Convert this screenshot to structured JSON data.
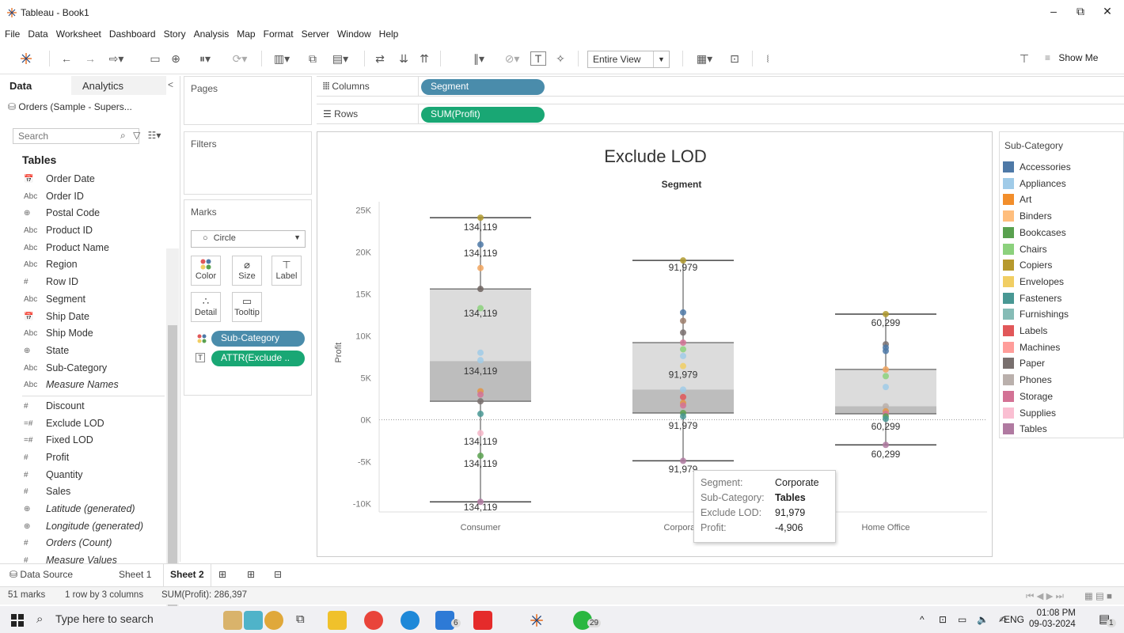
{
  "window": {
    "title": "Tableau - Book1",
    "minimize": "–",
    "restore": "⧉",
    "close": "✕"
  },
  "menu": [
    "File",
    "Data",
    "Worksheet",
    "Dashboard",
    "Story",
    "Analysis",
    "Map",
    "Format",
    "Server",
    "Window",
    "Help"
  ],
  "toolbar": {
    "fit_value": "Entire View",
    "show_me_label": "Show Me"
  },
  "data_pane": {
    "tab_data": "Data",
    "tab_analytics": "Analytics",
    "datasource": "Orders (Sample - Supers...",
    "search_placeholder": "Search",
    "tables_heading": "Tables",
    "dimensions": [
      {
        "type": "date",
        "icon": "📅",
        "name": "Order Date"
      },
      {
        "type": "abc",
        "icon": "Abc",
        "name": "Order ID"
      },
      {
        "type": "geo",
        "icon": "⊕",
        "name": "Postal Code"
      },
      {
        "type": "abc",
        "icon": "Abc",
        "name": "Product ID"
      },
      {
        "type": "abc",
        "icon": "Abc",
        "name": "Product Name"
      },
      {
        "type": "abc",
        "icon": "Abc",
        "name": "Region"
      },
      {
        "type": "num",
        "icon": "#",
        "name": "Row ID"
      },
      {
        "type": "abc",
        "icon": "Abc",
        "name": "Segment"
      },
      {
        "type": "date",
        "icon": "📅",
        "name": "Ship Date"
      },
      {
        "type": "abc",
        "icon": "Abc",
        "name": "Ship Mode"
      },
      {
        "type": "geo",
        "icon": "⊕",
        "name": "State"
      },
      {
        "type": "abc",
        "icon": "Abc",
        "name": "Sub-Category"
      },
      {
        "type": "abc",
        "icon": "Abc",
        "name": "Measure Names",
        "italic": true
      }
    ],
    "measures": [
      {
        "type": "num",
        "icon": "#",
        "name": "Discount"
      },
      {
        "type": "calc",
        "icon": "=#",
        "name": "Exclude LOD"
      },
      {
        "type": "calc",
        "icon": "=#",
        "name": "Fixed LOD"
      },
      {
        "type": "num",
        "icon": "#",
        "name": "Profit"
      },
      {
        "type": "num",
        "icon": "#",
        "name": "Quantity"
      },
      {
        "type": "num",
        "icon": "#",
        "name": "Sales"
      },
      {
        "type": "geo",
        "icon": "⊕",
        "name": "Latitude (generated)",
        "italic": true
      },
      {
        "type": "geo",
        "icon": "⊕",
        "name": "Longitude (generated)",
        "italic": true
      },
      {
        "type": "num",
        "icon": "#",
        "name": "Orders (Count)",
        "italic": true
      },
      {
        "type": "num",
        "icon": "#",
        "name": "Measure Values",
        "italic": true
      }
    ]
  },
  "cards": {
    "pages": "Pages",
    "filters": "Filters",
    "marks": "Marks",
    "mark_type": "Circle",
    "mark_buttons": [
      {
        "icon": "color-icon",
        "label": "Color"
      },
      {
        "icon": "size-icon",
        "label": "Size"
      },
      {
        "icon": "label-icon",
        "label": "Label"
      },
      {
        "icon": "detail-icon",
        "label": "Detail"
      },
      {
        "icon": "tooltip-icon",
        "label": "Tooltip"
      }
    ],
    "mark_pills": [
      {
        "label": "Sub-Category",
        "color": "#4a8cab"
      },
      {
        "label": "ATTR(Exclude ..",
        "color": "#19a774"
      }
    ]
  },
  "shelves": {
    "columns_label": "Columns",
    "columns_pill": "Segment",
    "rows_label": "Rows",
    "rows_pill": "SUM(Profit)"
  },
  "chart_data": {
    "type": "scatter",
    "title": "Exclude LOD",
    "header": "Segment",
    "ylabel": "Profit",
    "ylim": [
      -11000,
      26000
    ],
    "yticks": [
      {
        "v": 25000,
        "label": "25K"
      },
      {
        "v": 20000,
        "label": "20K"
      },
      {
        "v": 15000,
        "label": "15K"
      },
      {
        "v": 10000,
        "label": "10K"
      },
      {
        "v": 5000,
        "label": "5K"
      },
      {
        "v": 0,
        "label": "0K"
      },
      {
        "v": -5000,
        "label": "-5K"
      },
      {
        "v": -10000,
        "label": "-10K"
      }
    ],
    "categories": [
      "Consumer",
      "Corporate",
      "Home Office"
    ],
    "boxes": [
      {
        "category": "Consumer",
        "min": -9800,
        "q1": 2200,
        "median": 7000,
        "q3": 15600,
        "max": 24100
      },
      {
        "category": "Corporate",
        "min": -4906,
        "q1": 800,
        "median": 3600,
        "q3": 9200,
        "max": 19000
      },
      {
        "category": "Home Office",
        "min": -3000,
        "q1": 700,
        "median": 1600,
        "q3": 6000,
        "max": 12600
      }
    ],
    "labels": [
      {
        "category": "Consumer",
        "y": 22600,
        "text": "134,119"
      },
      {
        "category": "Consumer",
        "y": 19500,
        "text": "134,119"
      },
      {
        "category": "Consumer",
        "y": 12300,
        "text": "134,119"
      },
      {
        "category": "Consumer",
        "y": 5400,
        "text": "134,119"
      },
      {
        "category": "Consumer",
        "y": -3000,
        "text": "134,119"
      },
      {
        "category": "Consumer",
        "y": -5600,
        "text": "134,119"
      },
      {
        "category": "Consumer",
        "y": -10800,
        "text": "134,119"
      },
      {
        "category": "Corporate",
        "y": 17800,
        "text": "91,979"
      },
      {
        "category": "Corporate",
        "y": 5000,
        "text": "91,979"
      },
      {
        "category": "Corporate",
        "y": -1100,
        "text": "91,979"
      },
      {
        "category": "Corporate",
        "y": -6300,
        "text": "91,979"
      },
      {
        "category": "Home Office",
        "y": 11200,
        "text": "60,299"
      },
      {
        "category": "Home Office",
        "y": -1200,
        "text": "60,299"
      },
      {
        "category": "Home Office",
        "y": -4500,
        "text": "60,299"
      }
    ],
    "points": [
      {
        "category": "Consumer",
        "y": 24100,
        "color": "#b09a2e"
      },
      {
        "category": "Consumer",
        "y": 20900,
        "color": "#4e79a7"
      },
      {
        "category": "Consumer",
        "y": 18100,
        "color": "#f1a55e"
      },
      {
        "category": "Consumer",
        "y": 15600,
        "color": "#6f6460"
      },
      {
        "category": "Consumer",
        "y": 13300,
        "color": "#8cd17d"
      },
      {
        "category": "Consumer",
        "y": 8000,
        "color": "#a0cbe8"
      },
      {
        "category": "Consumer",
        "y": 7100,
        "color": "#a0cbe8"
      },
      {
        "category": "Consumer",
        "y": 3400,
        "color": "#e49444"
      },
      {
        "category": "Consumer",
        "y": 3000,
        "color": "#d37295"
      },
      {
        "category": "Consumer",
        "y": 2200,
        "color": "#79706e"
      },
      {
        "category": "Consumer",
        "y": 700,
        "color": "#499894"
      },
      {
        "category": "Consumer",
        "y": -1600,
        "color": "#f4b6c8"
      },
      {
        "category": "Consumer",
        "y": -4300,
        "color": "#59a14f"
      },
      {
        "category": "Consumer",
        "y": -9800,
        "color": "#b07aa1"
      },
      {
        "category": "Corporate",
        "y": 19000,
        "color": "#b09a2e"
      },
      {
        "category": "Corporate",
        "y": 12800,
        "color": "#4e79a7"
      },
      {
        "category": "Corporate",
        "y": 11800,
        "color": "#9c7e6c"
      },
      {
        "category": "Corporate",
        "y": 10400,
        "color": "#79706e"
      },
      {
        "category": "Corporate",
        "y": 9200,
        "color": "#d37295"
      },
      {
        "category": "Corporate",
        "y": 8400,
        "color": "#8cd17d"
      },
      {
        "category": "Corporate",
        "y": 7600,
        "color": "#a0cbe8"
      },
      {
        "category": "Corporate",
        "y": 6400,
        "color": "#f1ce63"
      },
      {
        "category": "Corporate",
        "y": 3600,
        "color": "#a0cbe8"
      },
      {
        "category": "Corporate",
        "y": 2700,
        "color": "#e15759"
      },
      {
        "category": "Corporate",
        "y": 2000,
        "color": "#e49444"
      },
      {
        "category": "Corporate",
        "y": 1700,
        "color": "#d37295"
      },
      {
        "category": "Corporate",
        "y": 800,
        "color": "#59a14f"
      },
      {
        "category": "Corporate",
        "y": 400,
        "color": "#499894"
      },
      {
        "category": "Corporate",
        "y": -4906,
        "color": "#b07aa1"
      },
      {
        "category": "Home Office",
        "y": 12600,
        "color": "#b09a2e"
      },
      {
        "category": "Home Office",
        "y": 9000,
        "color": "#79706e"
      },
      {
        "category": "Home Office",
        "y": 8600,
        "color": "#4e79a7"
      },
      {
        "category": "Home Office",
        "y": 8200,
        "color": "#4e79a7"
      },
      {
        "category": "Home Office",
        "y": 6000,
        "color": "#f1a55e"
      },
      {
        "category": "Home Office",
        "y": 5200,
        "color": "#8cd17d"
      },
      {
        "category": "Home Office",
        "y": 3900,
        "color": "#a0cbe8"
      },
      {
        "category": "Home Office",
        "y": 1600,
        "color": "#bab0ac"
      },
      {
        "category": "Home Office",
        "y": 1000,
        "color": "#e49444"
      },
      {
        "category": "Home Office",
        "y": 700,
        "color": "#d37295"
      },
      {
        "category": "Home Office",
        "y": 400,
        "color": "#59a14f"
      },
      {
        "category": "Home Office",
        "y": 100,
        "color": "#499894"
      },
      {
        "category": "Home Office",
        "y": -3000,
        "color": "#b07aa1"
      }
    ]
  },
  "legend": {
    "title": "Sub-Category",
    "items": [
      {
        "name": "Accessories",
        "color": "#4e79a7"
      },
      {
        "name": "Appliances",
        "color": "#a0cbe8"
      },
      {
        "name": "Art",
        "color": "#f28e2b"
      },
      {
        "name": "Binders",
        "color": "#ffbe7d"
      },
      {
        "name": "Bookcases",
        "color": "#59a14f"
      },
      {
        "name": "Chairs",
        "color": "#8cd17d"
      },
      {
        "name": "Copiers",
        "color": "#b6992d"
      },
      {
        "name": "Envelopes",
        "color": "#f1ce63"
      },
      {
        "name": "Fasteners",
        "color": "#499894"
      },
      {
        "name": "Furnishings",
        "color": "#86bcb6"
      },
      {
        "name": "Labels",
        "color": "#e15759"
      },
      {
        "name": "Machines",
        "color": "#ff9d9a"
      },
      {
        "name": "Paper",
        "color": "#79706e"
      },
      {
        "name": "Phones",
        "color": "#bab0ac"
      },
      {
        "name": "Storage",
        "color": "#d37295"
      },
      {
        "name": "Supplies",
        "color": "#fabfd2"
      },
      {
        "name": "Tables",
        "color": "#b07aa1"
      }
    ]
  },
  "tooltip": {
    "rows": [
      {
        "key": "Segment:",
        "value": "Corporate",
        "bold": false
      },
      {
        "key": "Sub-Category:",
        "value": "Tables",
        "bold": true
      },
      {
        "key": "Exclude LOD:",
        "value": "91,979",
        "bold": false
      },
      {
        "key": "Profit:",
        "value": "-4,906",
        "bold": false
      }
    ]
  },
  "sheets": {
    "data_source": "Data Source",
    "tabs": [
      "Sheet 1",
      "Sheet 2"
    ],
    "active": "Sheet 2"
  },
  "status": {
    "marks": "51 marks",
    "dims": "1 row by 3 columns",
    "sum": "SUM(Profit): 286,397"
  },
  "taskbar": {
    "search_placeholder": "Type here to search",
    "mail_badge": "6",
    "whatsapp_badge": "29",
    "lang": "ENG",
    "time": "01:08 PM",
    "date": "09-03-2024",
    "notif_badge": "1"
  }
}
